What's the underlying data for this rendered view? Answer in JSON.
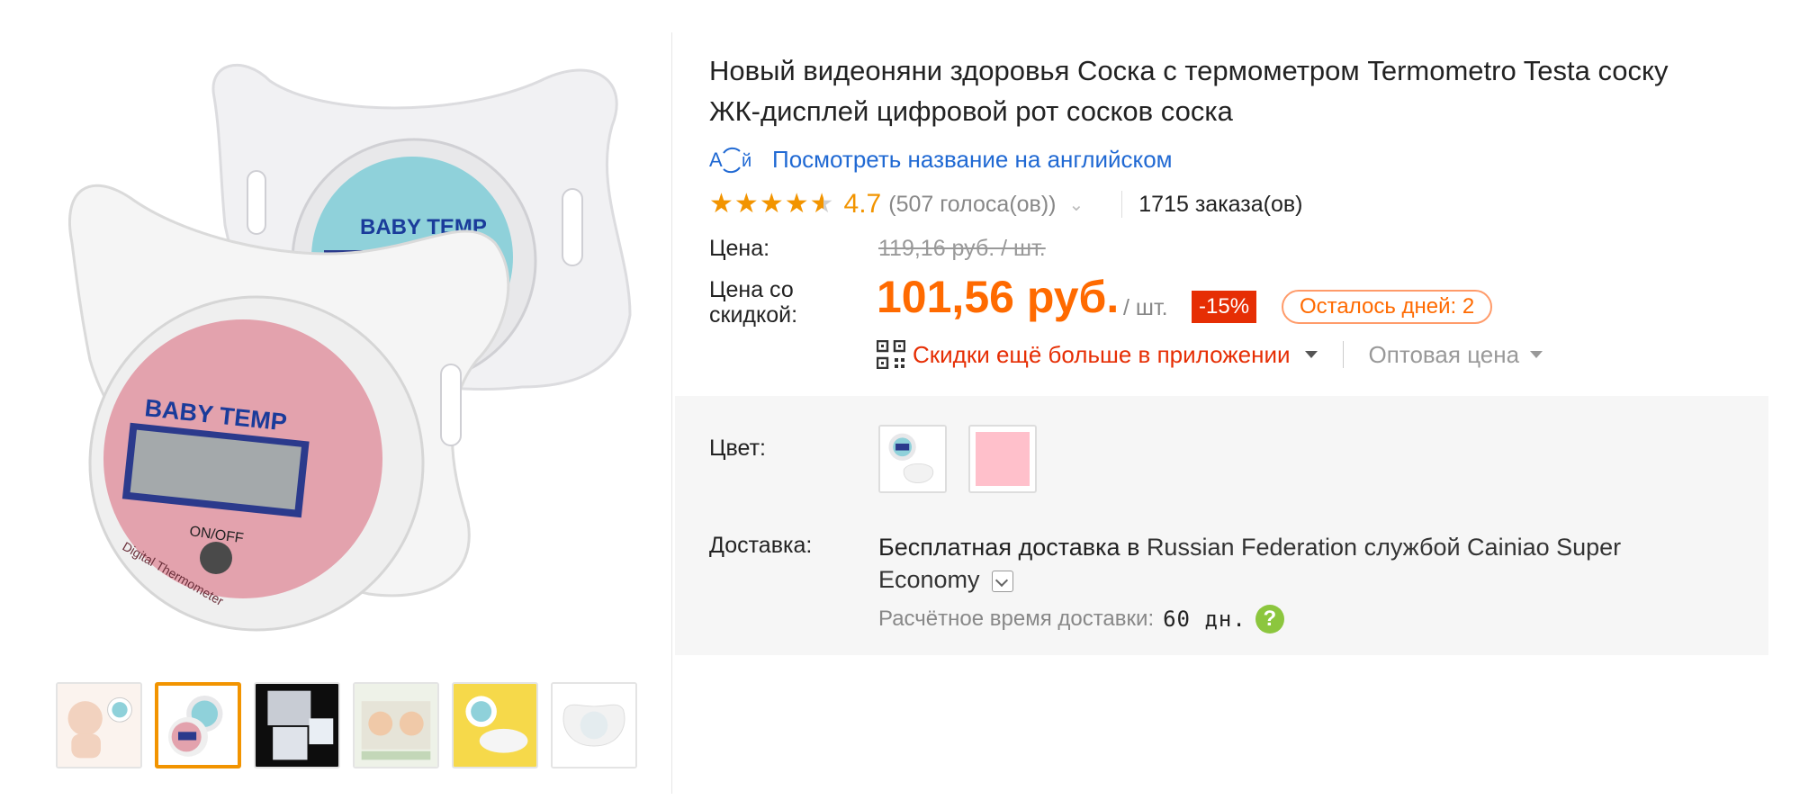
{
  "product": {
    "title": "Новый видеоняни здоровья Соска с термометром Termometro Testa соску ЖК-дисплей цифровой рот сосков соска",
    "translate_link": "Посмотреть название на английском",
    "rating_value": "4.7",
    "rating_stars": 4.7,
    "votes": "(507 голоса(ов))",
    "orders": "1715 заказа(ов)"
  },
  "price": {
    "label": "Цена:",
    "old": "119,16 руб. / шт.",
    "sale_label": "Цена со скидкой:",
    "sale": "101,56 руб.",
    "per_unit": "/ шт.",
    "discount": "-15%",
    "days_left": "Осталось дней: 2"
  },
  "app_promo": {
    "text": "Скидки ещё больше в приложении",
    "wholesale": "Оптовая цена"
  },
  "sku": {
    "color_label": "Цвет:",
    "colors": [
      "blue-pacifier",
      "pink"
    ]
  },
  "shipping": {
    "label": "Доставка:",
    "prefix": "Бесплатная доставка в",
    "details": "Russian Federation службой Cainiao Super Economy",
    "eta_label": "Расчётное время доставки:",
    "eta_value": "60 дн.",
    "help": "?"
  },
  "gallery": {
    "main_labels": {
      "back_display": "BABY TEMP",
      "front_display": "BABY TEMP",
      "switch": "ON/OFF",
      "brand_text": "Digital Thermometer"
    },
    "thumbnails": [
      "baby-with-pacifier",
      "pink-pacifier",
      "packaging-dark",
      "product-box",
      "yellow-background",
      "white-pacifier"
    ],
    "active_thumbnail": 1
  },
  "colors": {
    "accent": "#ff6a00",
    "link": "#2069d3",
    "discount_red": "#e62e04",
    "star": "#f29400"
  }
}
